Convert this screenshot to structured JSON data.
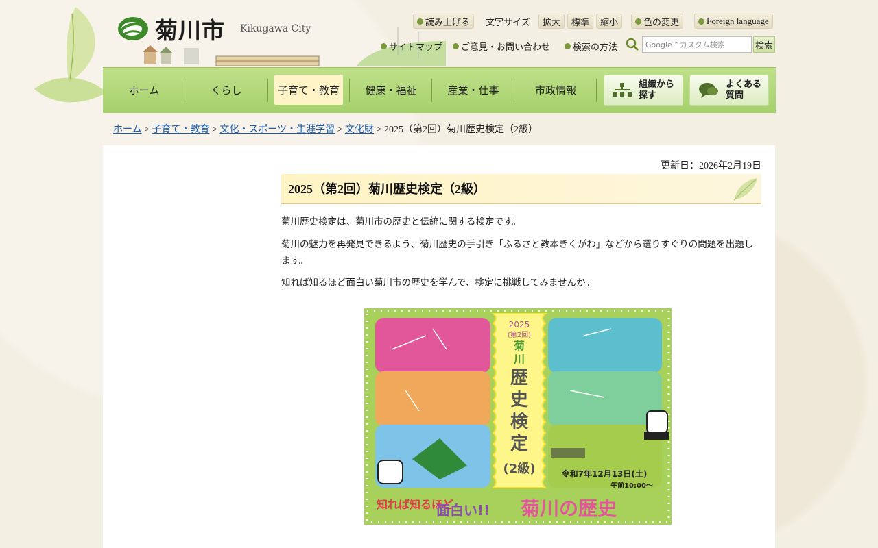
{
  "site": {
    "name": "菊川市",
    "name_en": "Kikugawa City"
  },
  "header": {
    "read_aloud": "読み上げる",
    "font_size_label": "文字サイズ",
    "font_large": "拡大",
    "font_standard": "標準",
    "font_small": "縮小",
    "color_change": "色の変更",
    "foreign_language": "Foreign language",
    "sitemap": "サイトマップ",
    "contact": "ご意見・お問い合わせ",
    "search_help": "検索の方法",
    "search_placeholder": "カスタム検索",
    "search_google": "Google™",
    "search_button": "検索"
  },
  "nav": {
    "items": [
      "ホーム",
      "くらし",
      "子育て・教育",
      "健康・福祉",
      "産業・仕事",
      "市政情報"
    ],
    "active_index": 2,
    "org_search": [
      "組織から",
      "探す"
    ],
    "faq": [
      "よくある",
      "質問"
    ]
  },
  "breadcrumb": {
    "links": [
      "ホーム",
      "子育て・教育",
      "文化・スポーツ・生涯学習",
      "文化財"
    ],
    "current": "2025（第2回）菊川歴史検定（2級）",
    "separator": " > "
  },
  "page": {
    "updated": "更新日：2026年2月19日",
    "title": "2025（第2回）菊川歴史検定（2級）",
    "paragraphs": [
      "菊川歴史検定は、菊川市の歴史と伝統に関する検定です。",
      "菊川の魅力を再発見できるよう、菊川歴史の手引き「ふるさと教本きくがわ」などから選りすぐりの問題を出題します。",
      "知れば知るほど面白い菊川市の歴史を学んで、検定に挑戦してみませんか。"
    ]
  },
  "poster": {
    "year": "2025",
    "round": "(第2回)",
    "title_chars": [
      "菊",
      "川",
      "歴",
      "史",
      "検",
      "定"
    ],
    "grade": "(2級)",
    "date": "令和7年12月13日(土)",
    "time": "午前10:00〜",
    "slogan_1": "知れば知るほど",
    "slogan_2": "面白い!!",
    "slogan_3": "菊川の歴史",
    "colors": {
      "frame": "#a8d15c",
      "pink": "#e2579a",
      "orange": "#f0a85a",
      "blue": "#7ec3e8",
      "teal": "#5dbfce",
      "mint": "#7ecf9c",
      "lime": "#a6cc4e",
      "center": "#fff68a"
    }
  },
  "colors": {
    "link": "#1a5aa8",
    "nav_bg": "#b3d879",
    "nav_active": "#fff4c8"
  }
}
